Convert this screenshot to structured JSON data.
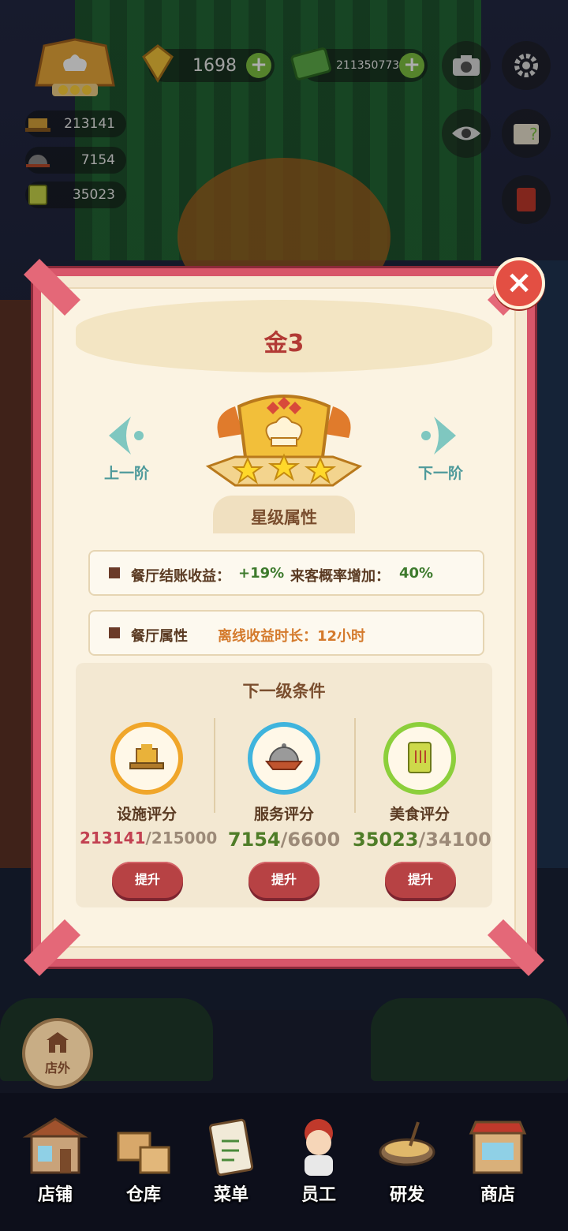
{
  "hud": {
    "gems": "1698",
    "cash": "211350773",
    "stats": {
      "facility": "213141",
      "service": "7154",
      "food": "35023"
    }
  },
  "dialog": {
    "title": "金3",
    "prev_label": "上一阶",
    "next_label": "下一阶",
    "attrs_title": "星级属性",
    "attr_row1": {
      "income_label": "餐厅结账收益：",
      "income_value": "+19%",
      "visitor_label": "来客概率增加：",
      "visitor_value": "40%"
    },
    "attr_row2": {
      "label": "餐厅属性",
      "offline_text": "离线收益时长：12小时"
    },
    "next_cond_title": "下一级条件",
    "requirements": [
      {
        "label": "设施评分",
        "current": "213141",
        "target": "/215000",
        "button": "提升"
      },
      {
        "label": "服务评分",
        "current": "7154",
        "target": "/6600",
        "button": "提升"
      },
      {
        "label": "美食评分",
        "current": "35023",
        "target": "/34100",
        "button": "提升"
      }
    ]
  },
  "bottom": {
    "outside": "店外",
    "nav": [
      "店铺",
      "仓库",
      "菜单",
      "员工",
      "研发",
      "商店"
    ]
  },
  "colors": {
    "dialog_border": "#d8566a",
    "close_button": "#e34f43",
    "title_text": "#b23a35",
    "boost_button": "#b74244",
    "value_below_target": "#c24151",
    "value_met_target": "#4f7d28"
  }
}
